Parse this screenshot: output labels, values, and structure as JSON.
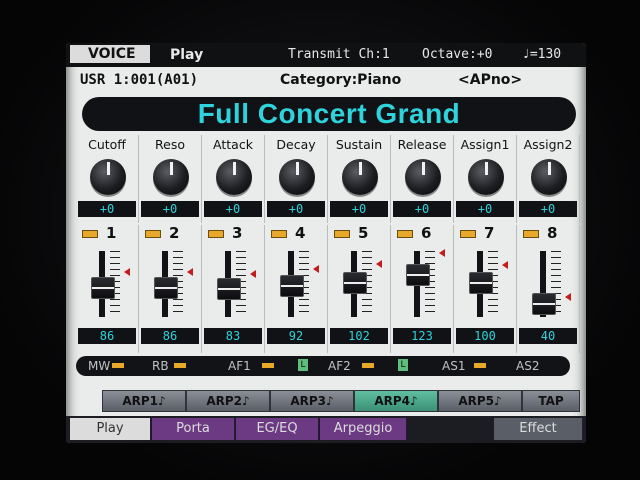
{
  "header": {
    "mode_tab": "VOICE",
    "sub_mode": "Play",
    "transmit": "Transmit Ch:1",
    "octave": "Octave:+0",
    "tempo": "♩=130"
  },
  "info": {
    "bank": "USR 1:001(A01)",
    "category": "Category:Piano",
    "subcategory": "<APno>"
  },
  "voice_name": "Full Concert Grand",
  "knobs": [
    {
      "label": "Cutoff",
      "value": "+0"
    },
    {
      "label": "Reso",
      "value": "+0"
    },
    {
      "label": "Attack",
      "value": "+0"
    },
    {
      "label": "Decay",
      "value": "+0"
    },
    {
      "label": "Sustain",
      "value": "+0"
    },
    {
      "label": "Release",
      "value": "+0"
    },
    {
      "label": "Assign1",
      "value": "+0"
    },
    {
      "label": "Assign2",
      "value": "+0"
    }
  ],
  "sliders": [
    {
      "num": "1",
      "value": "86",
      "level": 0.68
    },
    {
      "num": "2",
      "value": "86",
      "level": 0.68
    },
    {
      "num": "3",
      "value": "83",
      "level": 0.65
    },
    {
      "num": "4",
      "value": "92",
      "level": 0.72
    },
    {
      "num": "5",
      "value": "102",
      "level": 0.8
    },
    {
      "num": "6",
      "value": "123",
      "level": 0.97
    },
    {
      "num": "7",
      "value": "100",
      "level": 0.79
    },
    {
      "num": "8",
      "value": "40",
      "level": 0.31
    }
  ],
  "controllers": {
    "mw": "MW",
    "rb": "RB",
    "af1": "AF1",
    "af2": "AF2",
    "as1": "AS1",
    "as2": "AS2",
    "lock": "L"
  },
  "arps": [
    {
      "label": "ARP1♪"
    },
    {
      "label": "ARP2♪"
    },
    {
      "label": "ARP3♪"
    },
    {
      "label": "ARP4♪"
    },
    {
      "label": "ARP5♪"
    },
    {
      "label": "TAP"
    }
  ],
  "tabs": [
    {
      "label": "Play"
    },
    {
      "label": "Porta"
    },
    {
      "label": "EG/EQ"
    },
    {
      "label": "Arpeggio"
    },
    {
      "label": "Effect"
    }
  ],
  "colors": {
    "accent": "#2fd3dc",
    "led": "#e7a82b",
    "tab_purple": "#6b3a82"
  }
}
